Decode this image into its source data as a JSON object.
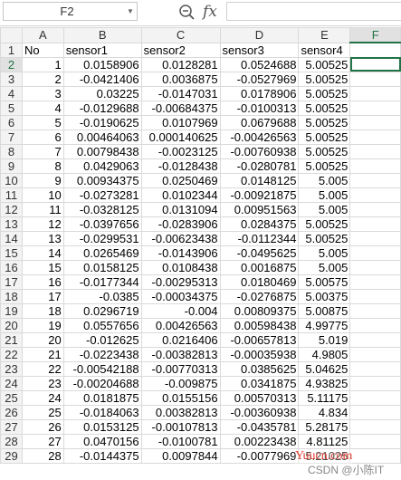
{
  "formula_bar": {
    "name_box": "F2",
    "formula": "",
    "icons": [
      "zoom-icon",
      "fx-icon",
      "chevron-down-icon"
    ]
  },
  "columns": [
    "A",
    "B",
    "C",
    "D",
    "E",
    "F"
  ],
  "selected": {
    "cell": "F2",
    "column": "F",
    "row": "2"
  },
  "rows": [
    {
      "n": "1",
      "cells": [
        "No",
        "sensor1",
        "sensor2",
        "sensor3",
        "sensor4",
        ""
      ]
    },
    {
      "n": "2",
      "cells": [
        "1",
        "0.0158906",
        "0.0128281",
        "0.0524688",
        "5.00525",
        ""
      ]
    },
    {
      "n": "3",
      "cells": [
        "2",
        "-0.0421406",
        "0.0036875",
        "-0.0527969",
        "5.00525",
        ""
      ]
    },
    {
      "n": "4",
      "cells": [
        "3",
        "0.03225",
        "-0.0147031",
        "0.0178906",
        "5.00525",
        ""
      ]
    },
    {
      "n": "5",
      "cells": [
        "4",
        "-0.0129688",
        "-0.00684375",
        "-0.0100313",
        "5.00525",
        ""
      ]
    },
    {
      "n": "6",
      "cells": [
        "5",
        "-0.0190625",
        "0.0107969",
        "0.0679688",
        "5.00525",
        ""
      ]
    },
    {
      "n": "7",
      "cells": [
        "6",
        "0.00464063",
        "0.000140625",
        "-0.00426563",
        "5.00525",
        ""
      ]
    },
    {
      "n": "8",
      "cells": [
        "7",
        "0.00798438",
        "-0.0023125",
        "-0.00760938",
        "5.00525",
        ""
      ]
    },
    {
      "n": "9",
      "cells": [
        "8",
        "0.0429063",
        "-0.0128438",
        "-0.0280781",
        "5.00525",
        ""
      ]
    },
    {
      "n": "10",
      "cells": [
        "9",
        "0.00934375",
        "0.0250469",
        "0.0148125",
        "5.005",
        ""
      ]
    },
    {
      "n": "11",
      "cells": [
        "10",
        "-0.0273281",
        "0.0102344",
        "-0.00921875",
        "5.005",
        ""
      ]
    },
    {
      "n": "12",
      "cells": [
        "11",
        "-0.0328125",
        "0.0131094",
        "0.00951563",
        "5.005",
        ""
      ]
    },
    {
      "n": "13",
      "cells": [
        "12",
        "-0.0397656",
        "-0.0283906",
        "0.0284375",
        "5.00525",
        ""
      ]
    },
    {
      "n": "14",
      "cells": [
        "13",
        "-0.0299531",
        "-0.00623438",
        "-0.0112344",
        "5.00525",
        ""
      ]
    },
    {
      "n": "15",
      "cells": [
        "14",
        "0.0265469",
        "-0.0143906",
        "-0.0495625",
        "5.005",
        ""
      ]
    },
    {
      "n": "16",
      "cells": [
        "15",
        "0.0158125",
        "0.0108438",
        "0.0016875",
        "5.005",
        ""
      ]
    },
    {
      "n": "17",
      "cells": [
        "16",
        "-0.0177344",
        "-0.00295313",
        "0.0180469",
        "5.00575",
        ""
      ]
    },
    {
      "n": "18",
      "cells": [
        "17",
        "-0.0385",
        "-0.00034375",
        "-0.0276875",
        "5.00375",
        ""
      ]
    },
    {
      "n": "19",
      "cells": [
        "18",
        "0.0296719",
        "-0.004",
        "0.00809375",
        "5.00875",
        ""
      ]
    },
    {
      "n": "20",
      "cells": [
        "19",
        "0.0557656",
        "0.00426563",
        "0.00598438",
        "4.99775",
        ""
      ]
    },
    {
      "n": "21",
      "cells": [
        "20",
        "-0.012625",
        "0.0216406",
        "-0.00657813",
        "5.019",
        ""
      ]
    },
    {
      "n": "22",
      "cells": [
        "21",
        "-0.0223438",
        "-0.00382813",
        "-0.00035938",
        "4.9805",
        ""
      ]
    },
    {
      "n": "23",
      "cells": [
        "22",
        "-0.00542188",
        "-0.00770313",
        "0.0385625",
        "5.04625",
        ""
      ]
    },
    {
      "n": "24",
      "cells": [
        "23",
        "-0.00204688",
        "-0.009875",
        "0.0341875",
        "4.93825",
        ""
      ]
    },
    {
      "n": "25",
      "cells": [
        "24",
        "0.0181875",
        "0.0155156",
        "0.00570313",
        "5.11175",
        ""
      ]
    },
    {
      "n": "26",
      "cells": [
        "25",
        "-0.0184063",
        "0.00382813",
        "-0.00360938",
        "4.834",
        ""
      ]
    },
    {
      "n": "27",
      "cells": [
        "26",
        "0.0153125",
        "-0.00107813",
        "-0.0435781",
        "5.28175",
        ""
      ]
    },
    {
      "n": "28",
      "cells": [
        "27",
        "0.0470156",
        "-0.0100781",
        "0.00223438",
        "4.81125",
        ""
      ]
    },
    {
      "n": "29",
      "cells": [
        "28",
        "-0.0144375",
        "0.0097844",
        "-0.0077969",
        "5.21025",
        ""
      ]
    }
  ],
  "watermarks": {
    "site": "Yuucn.com",
    "csdn": "CSDN @小陈IT"
  }
}
